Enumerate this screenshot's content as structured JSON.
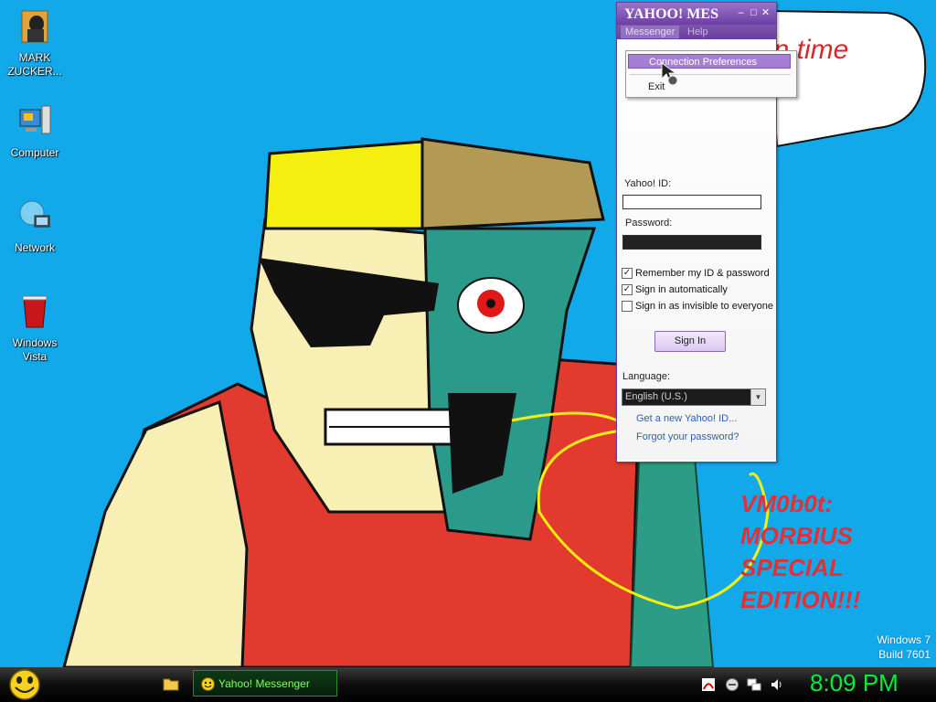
{
  "desktop": {
    "icons": [
      {
        "label": "MARK ZUCKER...",
        "icon": "user-folder-icon"
      },
      {
        "label": "Computer",
        "icon": "computer-icon"
      },
      {
        "label": "Network",
        "icon": "network-globe-icon"
      },
      {
        "label": "Windows Vista",
        "icon": "recycle-bin-icon"
      }
    ],
    "wallpaper": {
      "speech_text": "in time",
      "caption_lines": [
        "VM0b0t:",
        "MORBIUS",
        "SPECIAL",
        "EDITION!!!"
      ]
    },
    "watermark": {
      "line1": "Windows 7",
      "line2": "Build 7601"
    }
  },
  "messenger": {
    "title": "YAHOO! MES",
    "menus": [
      "Messenger",
      "Help"
    ],
    "context_menu": {
      "item1": "Connection Preferences",
      "item2": "Exit"
    },
    "yahoo_id_label": "Yahoo! ID:",
    "yahoo_id_value": "",
    "password_label": "Password:",
    "password_value": "",
    "options": [
      {
        "label": "Remember my ID & password",
        "checked": true
      },
      {
        "label": "Sign in automatically",
        "checked": true
      },
      {
        "label": "Sign in as invisible to everyone",
        "checked": false
      }
    ],
    "sign_in_label": "Sign In",
    "language_label": "Language:",
    "language_value": "English (U.S.)",
    "links": [
      "Get a new Yahoo! ID...",
      "Forgot your password?"
    ]
  },
  "taskbar": {
    "task_label": "Yahoo! Messenger",
    "clock": "8:09 PM",
    "tray_icons": [
      "acrobat-icon",
      "messenger-status-icon",
      "network-icon",
      "volume-icon"
    ]
  },
  "colors": {
    "desktop_bg": "#12a9ea",
    "messenger_purple": "#6c3ea3",
    "clock_green": "#00ef3c",
    "caption_red": "#e0303a"
  }
}
